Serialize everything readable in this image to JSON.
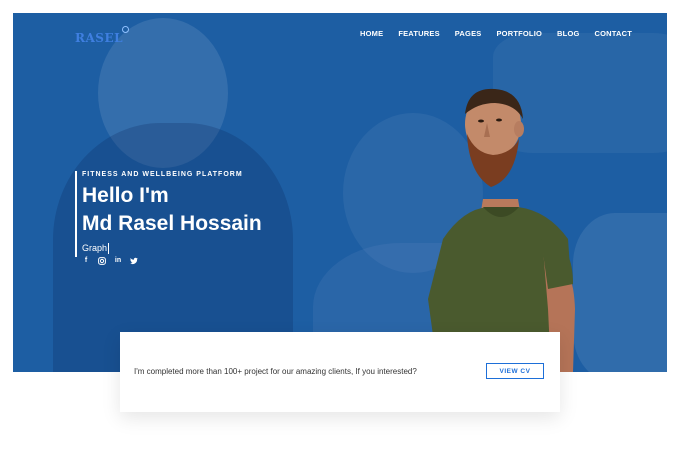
{
  "brand": {
    "logo_text": "RASEL"
  },
  "nav": {
    "items": [
      {
        "label": "HOME"
      },
      {
        "label": "FEATURES"
      },
      {
        "label": "PAGES"
      },
      {
        "label": "PORTFOLIO"
      },
      {
        "label": "BLOG"
      },
      {
        "label": "CONTACT"
      }
    ]
  },
  "hero": {
    "tagline": "FITNESS AND WELLBEING PLATFORM",
    "headline_line1": "Hello I'm",
    "headline_line2": "Md Rasel Hossain",
    "typed_text": "Graph",
    "socials": [
      {
        "icon": "facebook-icon",
        "glyph": "f"
      },
      {
        "icon": "instagram-icon",
        "glyph": ""
      },
      {
        "icon": "linkedin-icon",
        "glyph": "in"
      },
      {
        "icon": "twitter-icon",
        "glyph": ""
      }
    ]
  },
  "cta": {
    "text": "I'm completed more than 100+ project for our amazing clients, If you interested?",
    "button_label": "VIEW CV"
  },
  "colors": {
    "hero_bg": "#1d5ea3",
    "accent": "#1d6fd8",
    "logo": "#3f7fe0"
  }
}
